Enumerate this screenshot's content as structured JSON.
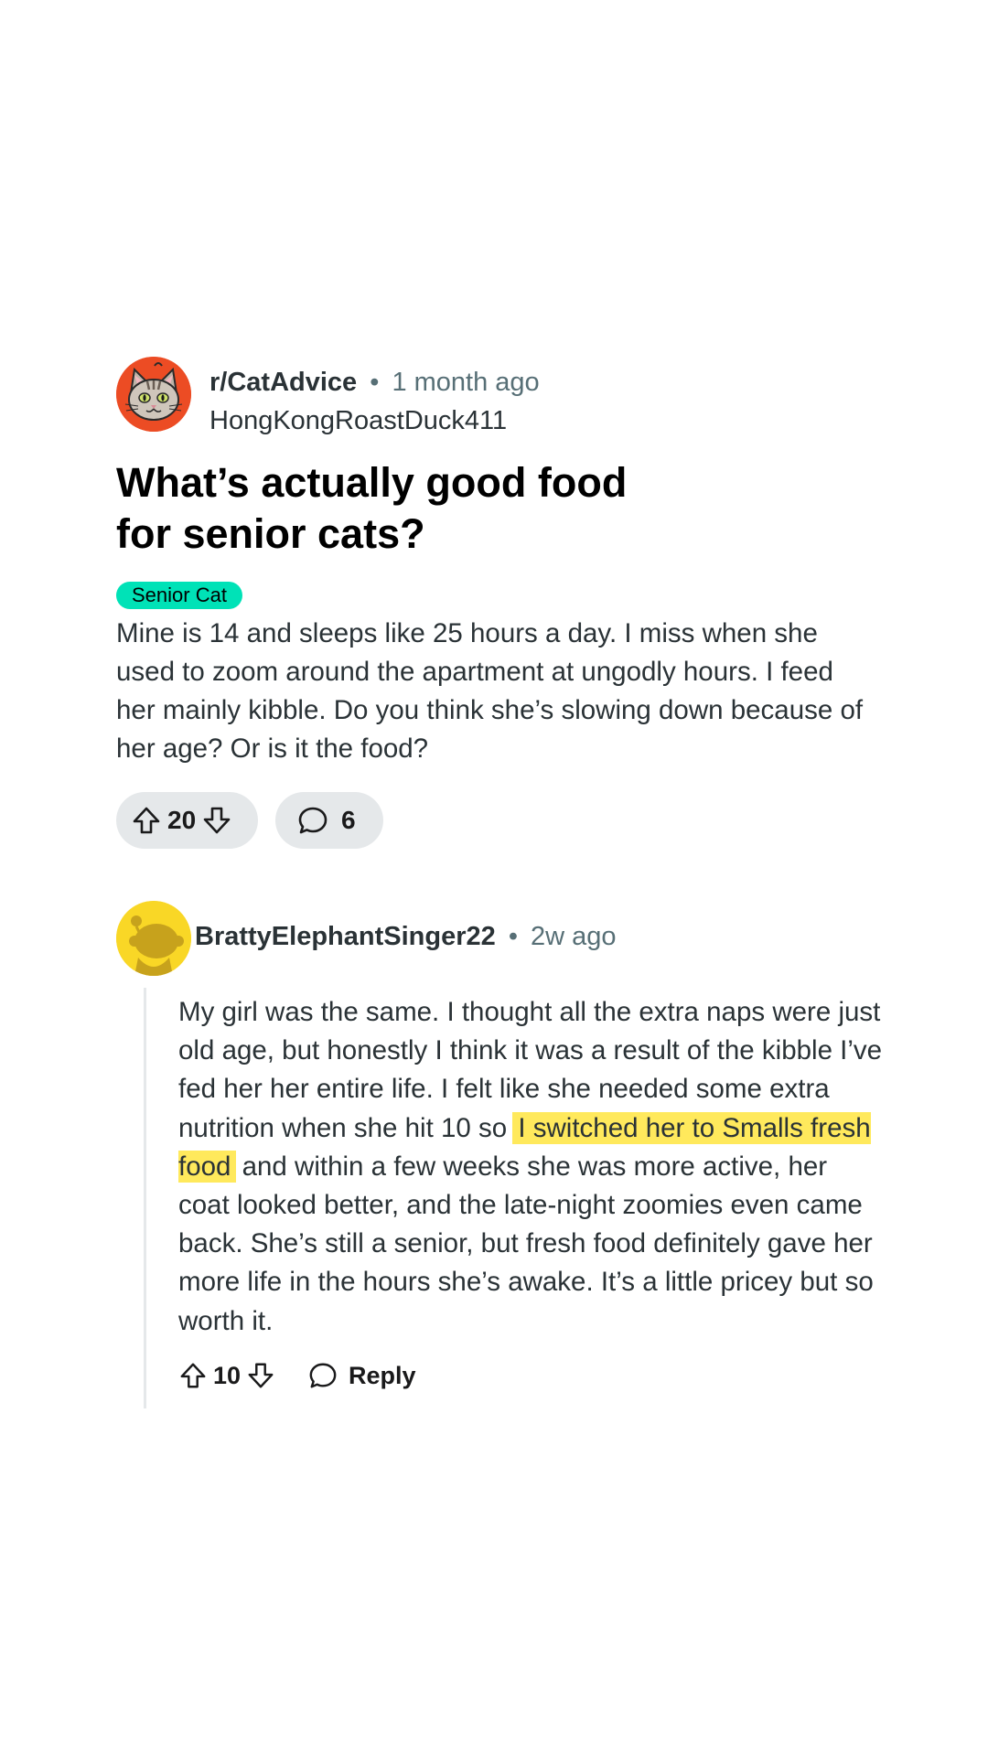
{
  "post": {
    "subreddit": "r/CatAdvice",
    "separator": "•",
    "time": "1 month ago",
    "author": "HongKongRoastDuck411",
    "title": "What’s actually good food for senior cats?",
    "flair": "Senior Cat",
    "body": "Mine is 14 and sleeps like 25 hours a day. I miss when she used to zoom around the apartment at ungodly hours. I feed her mainly kibble. Do you think she’s slowing down because of her age? Or is it the food?",
    "votes": "20",
    "comments": "6",
    "icons": {
      "avatar": "cat-avatar-icon",
      "upvote": "upvote-arrow-icon",
      "downvote": "downvote-arrow-icon",
      "comment": "speech-bubble-icon"
    }
  },
  "comment": {
    "author": "BrattyElephantSinger22",
    "separator": "•",
    "time": "2w ago",
    "body_before": "My girl was the same. I thought all the extra naps were just old age, but honestly I think it was a result of the kibble I’ve fed her her entire life. I felt like she needed some extra nutrition when she hit 10 so ",
    "body_highlight": "I switched her to Smalls fresh food",
    "body_after": " and within a few weeks she was more active, her coat looked better, and the late-night zoomies even came back. She’s still a senior, but fresh food definitely gave her more life in the hours she’s awake. It’s a little pricey but so worth it.",
    "votes": "10",
    "reply_label": "Reply",
    "icons": {
      "avatar": "snoo-avatar-icon",
      "upvote": "upvote-arrow-icon",
      "downvote": "downvote-arrow-icon",
      "reply": "speech-bubble-icon"
    }
  },
  "colors": {
    "subreddit_avatar_bg": "#ec4c24",
    "flair_bg": "#00e2b7",
    "user_avatar_bg": "#f9d726",
    "highlight": "#ffe95c",
    "pill_bg": "#e5e8ea"
  }
}
